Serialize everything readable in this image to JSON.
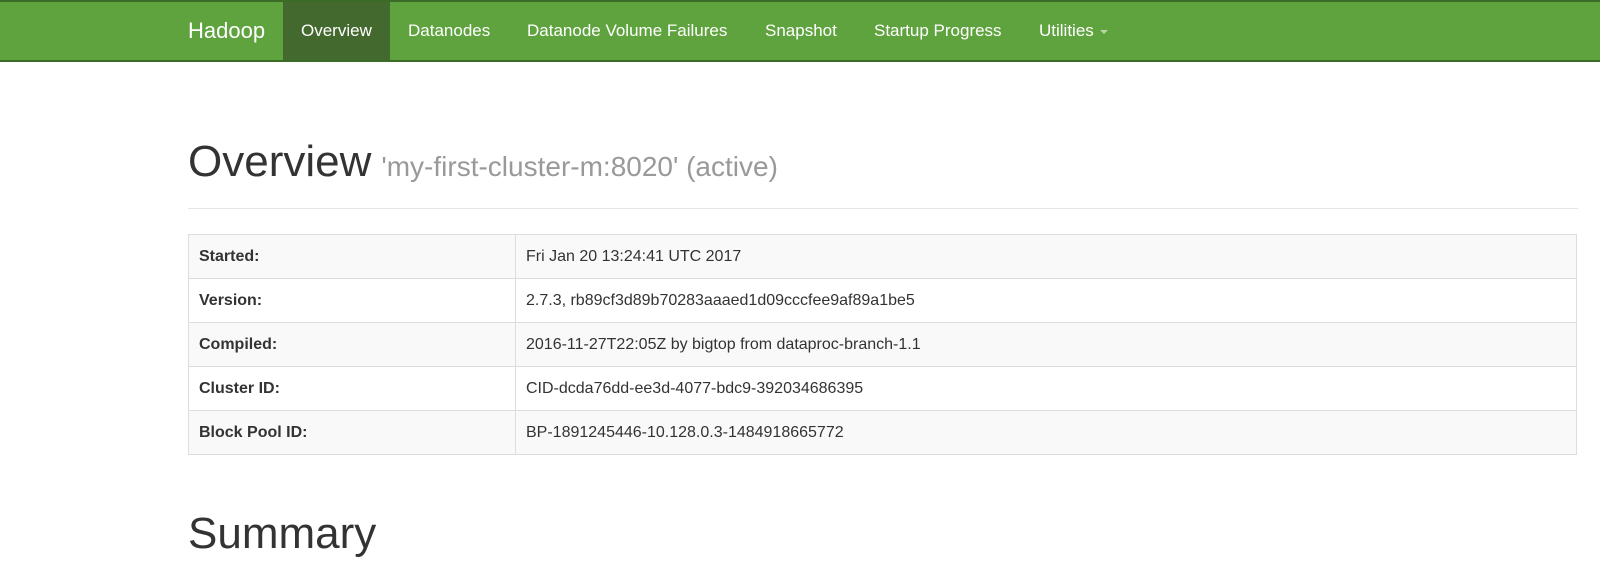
{
  "navbar": {
    "brand": "Hadoop",
    "items": [
      {
        "label": "Overview",
        "active": true
      },
      {
        "label": "Datanodes",
        "active": false
      },
      {
        "label": "Datanode Volume Failures",
        "active": false
      },
      {
        "label": "Snapshot",
        "active": false
      },
      {
        "label": "Startup Progress",
        "active": false
      },
      {
        "label": "Utilities",
        "active": false,
        "has_dropdown": true
      }
    ]
  },
  "header": {
    "title": "Overview",
    "subtitle": "'my-first-cluster-m:8020' (active)"
  },
  "info_table": {
    "rows": [
      {
        "label": "Started:",
        "value": "Fri Jan 20 13:24:41 UTC 2017"
      },
      {
        "label": "Version:",
        "value": "2.7.3, rb89cf3d89b70283aaaed1d09cccfee9af89a1be5"
      },
      {
        "label": "Compiled:",
        "value": "2016-11-27T22:05Z by bigtop from dataproc-branch-1.1"
      },
      {
        "label": "Cluster ID:",
        "value": "CID-dcda76dd-ee3d-4077-bdc9-392034686395"
      },
      {
        "label": "Block Pool ID:",
        "value": "BP-1891245446-10.128.0.3-1484918665772"
      }
    ]
  },
  "summary": {
    "title": "Summary"
  },
  "colors": {
    "navbar": "#5fa33e",
    "navbar_active": "#44692f",
    "text": "#333333",
    "muted": "#999999"
  }
}
